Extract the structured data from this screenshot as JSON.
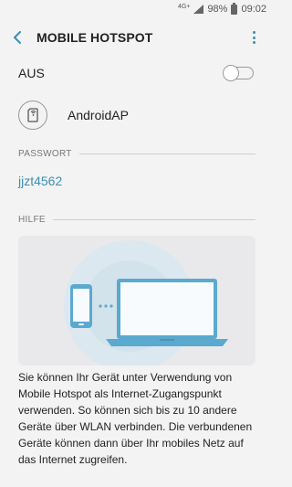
{
  "status_bar": {
    "network_type": "4G+",
    "battery": "98%",
    "time": "09:02"
  },
  "app_bar": {
    "title": "MOBILE HOTSPOT"
  },
  "toggle_row": {
    "label": "AUS",
    "state": "off"
  },
  "network": {
    "name": "AndroidAP"
  },
  "password_section": {
    "header": "PASSWORT",
    "value": "jjzt4562"
  },
  "help_section": {
    "header": "HILFE",
    "text": "Sie können Ihr Gerät unter Verwendung von Mobile Hotspot als Internet-Zugangspunkt verwenden. So können sich bis zu 10 andere Geräte über WLAN verbinden. Die verbundenen Geräte können dann über Ihr mobiles Netz auf das Internet zugreifen."
  },
  "colors": {
    "accent": "#3b8fb0",
    "background": "#f3f3f3",
    "illustration_bg": "#e9e9ec",
    "device_blue": "#5aa9cf"
  },
  "icons": {
    "back": "chevron-left-icon",
    "more": "more-vert-icon",
    "network": "phone-link-icon",
    "signal": "signal-icon",
    "battery": "battery-icon"
  }
}
